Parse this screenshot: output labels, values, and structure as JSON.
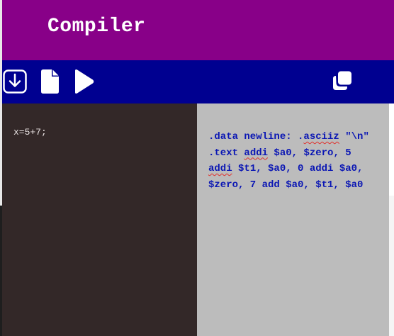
{
  "app": {
    "title": "Compiler"
  },
  "toolbar": {
    "buttons": [
      {
        "icon": "download-icon"
      },
      {
        "icon": "file-icon"
      },
      {
        "icon": "play-icon"
      },
      {
        "icon": "copy-icon"
      }
    ]
  },
  "editor": {
    "source": "x=5+7;"
  },
  "output": {
    "lines": [
      {
        "parts": [
          ".data newline: .",
          "asciiz",
          " \"\\n\""
        ]
      },
      {
        "parts": [
          ".text ",
          "addi",
          " $a0, $zero, 5"
        ]
      },
      {
        "parts": [
          "",
          "addi",
          " $t1, $a0, 0 addi $a0,"
        ]
      },
      {
        "parts": [
          "$zero, 7 add $a0, $t1, $a0",
          "",
          ""
        ]
      }
    ]
  },
  "colors": {
    "header": "#880088",
    "toolbar": "#000090",
    "editor_bg": "#332828",
    "output_bg": "#bcbcbc",
    "output_text": "#0a16b4"
  }
}
